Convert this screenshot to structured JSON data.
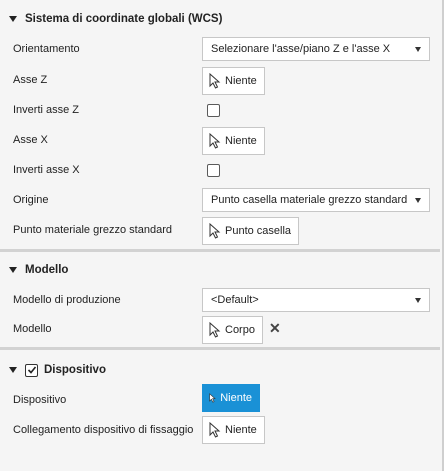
{
  "sections": {
    "wcs": {
      "title": "Sistema di coordinate globali (WCS)"
    },
    "model": {
      "title": "Modello"
    },
    "fixture": {
      "title": "Dispositivo",
      "enabled": true
    }
  },
  "wcs": {
    "orientation_label": "Orientamento",
    "orientation_value": "Selezionare l'asse/piano Z e l'asse X",
    "z_axis_label": "Asse Z",
    "z_axis_value": "Niente",
    "flip_z_label": "Inverti asse Z",
    "flip_z_checked": false,
    "x_axis_label": "Asse X",
    "x_axis_value": "Niente",
    "flip_x_label": "Inverti asse X",
    "flip_x_checked": false,
    "origin_label": "Origine",
    "origin_value": "Punto casella materiale grezzo standard",
    "stock_point_label": "Punto materiale grezzo standard",
    "stock_point_value": "Punto casella"
  },
  "model": {
    "production_model_label": "Modello di produzione",
    "production_model_value": "<Default>",
    "model_label": "Modello",
    "model_value": "Corpo"
  },
  "fixture": {
    "fixture_label": "Dispositivo",
    "fixture_value": "Niente",
    "link_label": "Collegamento dispositivo di fissaggio",
    "link_value": "Niente"
  },
  "colors": {
    "active_selection": "#1a91d6",
    "divider": "#d2d2d2",
    "background": "#f5f5f5"
  }
}
